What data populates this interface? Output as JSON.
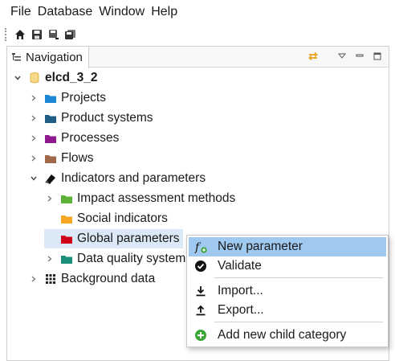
{
  "menubar": {
    "items": [
      "File",
      "Database",
      "Window",
      "Help"
    ]
  },
  "toolbar": {
    "buttons": [
      "home-icon",
      "save-icon",
      "save-as-icon",
      "save-all-icon"
    ]
  },
  "navigation": {
    "tab_label": "Navigation",
    "tab_icon": "tree-view-icon",
    "actions": [
      "link-with-editor-icon",
      "view-menu-icon",
      "minimize-icon",
      "maximize-icon"
    ]
  },
  "tree": {
    "root": {
      "label": "elcd_3_2",
      "icon": "database-icon",
      "expanded": true
    },
    "items": [
      {
        "label": "Projects",
        "icon": "folder-icon",
        "color": "#1e88d6",
        "expanded": false
      },
      {
        "label": "Product systems",
        "icon": "folder-icon",
        "color": "#1f5c86",
        "expanded": false
      },
      {
        "label": "Processes",
        "icon": "folder-icon",
        "color": "#8f1a8f",
        "expanded": false
      },
      {
        "label": "Flows",
        "icon": "folder-icon",
        "color": "#a0694a",
        "expanded": false
      },
      {
        "label": "Indicators and parameters",
        "icon": "indicators-icon",
        "expanded": true
      },
      {
        "label": "Impact assessment methods",
        "icon": "folder-icon",
        "color": "#5cb337",
        "expanded": false
      },
      {
        "label": "Social indicators",
        "icon": "folder-icon",
        "color": "#f5a623"
      },
      {
        "label": "Global parameters",
        "icon": "folder-icon",
        "color": "#d0021b",
        "selected": true
      },
      {
        "label": "Data quality systems",
        "icon": "folder-icon",
        "color": "#1a8f7a",
        "expanded": false
      },
      {
        "label": "Background data",
        "icon": "grid-icon",
        "expanded": false
      }
    ]
  },
  "context_menu": {
    "items": [
      {
        "label": "New parameter",
        "icon": "formula-icon",
        "highlighted": true
      },
      {
        "label": "Validate",
        "icon": "check-circle-icon"
      },
      {
        "label": "Import...",
        "icon": "import-icon"
      },
      {
        "label": "Export...",
        "icon": "export-icon"
      },
      {
        "label": "Add new child category",
        "icon": "add-circle-icon"
      }
    ]
  }
}
